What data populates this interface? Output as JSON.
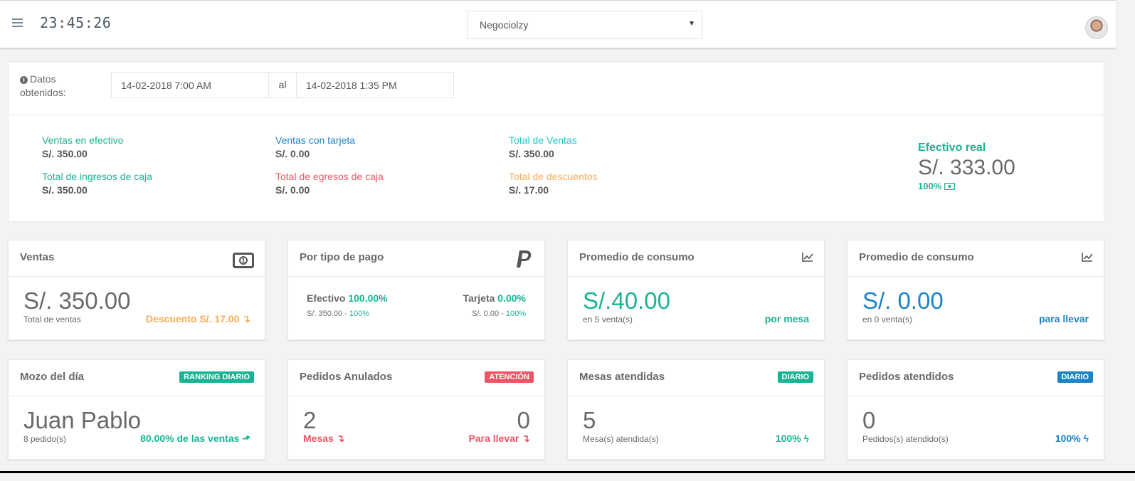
{
  "topbar": {
    "clock": "23:45:26",
    "business_select": "Negociolzy"
  },
  "summary": {
    "date_label": "Datos obtenidos:",
    "date_from": "14-02-2018 7:00 AM",
    "date_sep": "al",
    "date_to": "14-02-2018 1:35 PM",
    "ventas_efectivo_label": "Ventas en efectivo",
    "ventas_efectivo_value": "S/. 350.00",
    "ingresos_caja_label": "Total de ingresos de caja",
    "ingresos_caja_value": "S/. 350.00",
    "ventas_tarjeta_label": "Ventas con tarjeta",
    "ventas_tarjeta_value": "S/. 0.00",
    "egresos_caja_label": "Total de egresos de caja",
    "egresos_caja_value": "S/. 0.00",
    "total_ventas_label": "Total de Ventas",
    "total_ventas_value": "S/. 350.00",
    "descuentos_label": "Total de descuentos",
    "descuentos_value": "S/. 17.00",
    "efectivo_real_label": "Efectivo real",
    "efectivo_real_value": "S/. 333.00",
    "efectivo_real_pct": "100%"
  },
  "cards": {
    "ventas": {
      "title": "Ventas",
      "value": "S/. 350.00",
      "sub": "Total de ventas",
      "right": "Descuento S/. 17.00"
    },
    "tipo_pago": {
      "title": "Por tipo de pago",
      "efectivo_label": "Efectivo",
      "efectivo_pct": "100.00%",
      "efectivo_amount": "S/. 350.00 -",
      "efectivo_amount_pct": "100%",
      "tarjeta_label": "Tarjeta",
      "tarjeta_pct": "0.00%",
      "tarjeta_amount": "S/. 0.00 -",
      "tarjeta_amount_pct": "100%"
    },
    "promedio_mesa": {
      "title": "Promedio de consumo",
      "value": "S/.40.00",
      "sub": "en 5 venta(s)",
      "right": "por mesa"
    },
    "promedio_llevar": {
      "title": "Promedio de consumo",
      "value": "S/. 0.00",
      "sub": "en 0 venta(s)",
      "right": "para llevar"
    },
    "mozo": {
      "title": "Mozo del día",
      "badge": "RANKING DIARIO",
      "value": "Juan Pablo",
      "sub": "8 pedido(s)",
      "right": "80.00% de las ventas"
    },
    "anulados": {
      "title": "Pedidos Anulados",
      "badge": "ATENCIÓN",
      "left_value": "2",
      "left_label": "Mesas",
      "right_value": "0",
      "right_label": "Para llevar"
    },
    "mesas": {
      "title": "Mesas atendidas",
      "badge": "DIARIO",
      "value": "5",
      "sub": "Mesa(s) atendida(s)",
      "right": "100%"
    },
    "pedidos": {
      "title": "Pedidos atendidos",
      "badge": "DIARIO",
      "value": "0",
      "sub": "Pedidos(s) atendido(s)",
      "right": "100%"
    }
  },
  "colors": {
    "teal": "#1ab394",
    "blue": "#1c84c6",
    "red": "#ed5565",
    "orange": "#f8ac59",
    "cyan": "#23c6c8"
  }
}
